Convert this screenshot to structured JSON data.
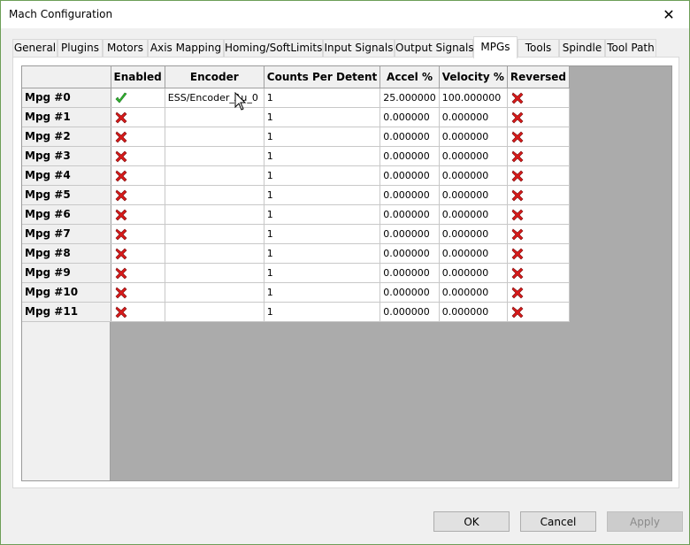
{
  "window": {
    "title": "Mach Configuration",
    "close_glyph": "✕"
  },
  "tabs": [
    {
      "label": "General"
    },
    {
      "label": "Plugins"
    },
    {
      "label": "Motors"
    },
    {
      "label": "Axis Mapping"
    },
    {
      "label": "Homing/SoftLimits"
    },
    {
      "label": "Input Signals"
    },
    {
      "label": "Output Signals"
    },
    {
      "label": "MPGs",
      "active": true
    },
    {
      "label": "Tools"
    },
    {
      "label": "Spindle"
    },
    {
      "label": "Tool Path"
    }
  ],
  "grid": {
    "columns": [
      "Enabled",
      "Encoder",
      "Counts Per Detent",
      "Accel %",
      "Velocity %",
      "Reversed"
    ],
    "rows": [
      {
        "name": "Mpg #0",
        "enabled": true,
        "encoder": "ESS/Encoder_Au_0",
        "counts": "1",
        "accel": "25.000000",
        "velocity": "100.000000",
        "reversed": false
      },
      {
        "name": "Mpg #1",
        "enabled": false,
        "encoder": "",
        "counts": "1",
        "accel": "0.000000",
        "velocity": "0.000000",
        "reversed": false
      },
      {
        "name": "Mpg #2",
        "enabled": false,
        "encoder": "",
        "counts": "1",
        "accel": "0.000000",
        "velocity": "0.000000",
        "reversed": false
      },
      {
        "name": "Mpg #3",
        "enabled": false,
        "encoder": "",
        "counts": "1",
        "accel": "0.000000",
        "velocity": "0.000000",
        "reversed": false
      },
      {
        "name": "Mpg #4",
        "enabled": false,
        "encoder": "",
        "counts": "1",
        "accel": "0.000000",
        "velocity": "0.000000",
        "reversed": false
      },
      {
        "name": "Mpg #5",
        "enabled": false,
        "encoder": "",
        "counts": "1",
        "accel": "0.000000",
        "velocity": "0.000000",
        "reversed": false
      },
      {
        "name": "Mpg #6",
        "enabled": false,
        "encoder": "",
        "counts": "1",
        "accel": "0.000000",
        "velocity": "0.000000",
        "reversed": false
      },
      {
        "name": "Mpg #7",
        "enabled": false,
        "encoder": "",
        "counts": "1",
        "accel": "0.000000",
        "velocity": "0.000000",
        "reversed": false
      },
      {
        "name": "Mpg #8",
        "enabled": false,
        "encoder": "",
        "counts": "1",
        "accel": "0.000000",
        "velocity": "0.000000",
        "reversed": false
      },
      {
        "name": "Mpg #9",
        "enabled": false,
        "encoder": "",
        "counts": "1",
        "accel": "0.000000",
        "velocity": "0.000000",
        "reversed": false
      },
      {
        "name": "Mpg #10",
        "enabled": false,
        "encoder": "",
        "counts": "1",
        "accel": "0.000000",
        "velocity": "0.000000",
        "reversed": false
      },
      {
        "name": "Mpg #11",
        "enabled": false,
        "encoder": "",
        "counts": "1",
        "accel": "0.000000",
        "velocity": "0.000000",
        "reversed": false
      }
    ]
  },
  "icons": {
    "true_icon": "green-check-icon",
    "false_icon": "red-x-icon",
    "check_color": "#2fb52f",
    "x_color": "#d81a1a"
  },
  "buttons": {
    "ok": "OK",
    "cancel": "Cancel",
    "apply": "Apply"
  }
}
